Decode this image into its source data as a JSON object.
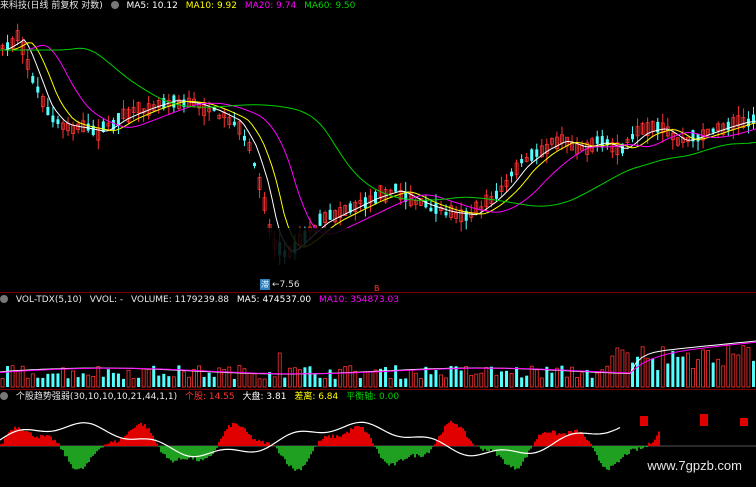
{
  "main_header": {
    "title": "来科技(日线 前复权 对数)",
    "ma5_label": "MA5: 10.12",
    "ma10_label": "MA10: 9.92",
    "ma20_label": "MA20: 9.74",
    "ma60_label": "MA60: 9.50"
  },
  "low_marker": {
    "badge": "滞",
    "text": "←7.56"
  },
  "signal_marker": "B",
  "vol_header": {
    "indicator": "VOL-TDX(5,10)",
    "vvol": "VVOL: -",
    "volume": "VOLUME: 1179239.88",
    "ma5": "MA5: 474537.00",
    "ma10": "MA10: 354873.03"
  },
  "trend_header": {
    "indicator": "个股趋势强弱(30,10,10,10,21,44,1,1)",
    "stock_label": "个股: 14.55",
    "market_label": "大盘: 3.81",
    "spread_label": "差离: 6.84",
    "balance_label": "平衡轴: 0.00"
  },
  "watermark": "www.7gpzb.com",
  "colors": {
    "up": "#ff3232",
    "down": "#54ffff",
    "ma5": "#ffffff",
    "ma10": "#ffff00",
    "ma20": "#ff00ff",
    "ma60": "#00d000",
    "separator": "#7a0000",
    "trend_pos": "#e00000",
    "trend_neg": "#20a020",
    "trend_line": "#ffffff"
  }
}
